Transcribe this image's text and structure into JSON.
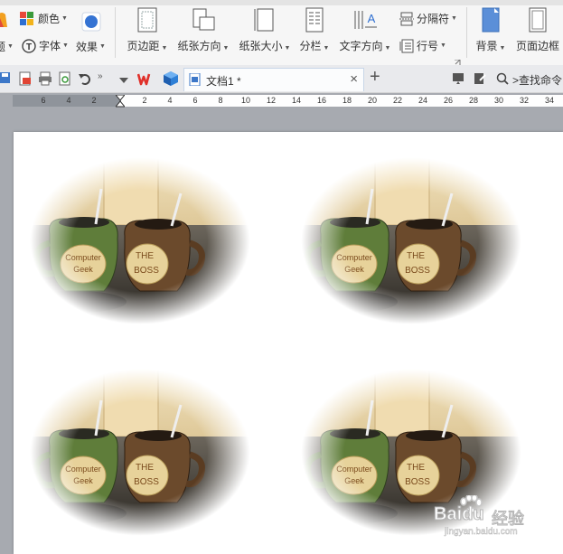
{
  "ribbon": {
    "color_label": "颜色",
    "font_label": "字体",
    "effect_label": "效果",
    "margin_label": "页边距",
    "orientation_label": "纸张方向",
    "size_label": "纸张大小",
    "columns_label": "分栏",
    "text_direction_label": "文字方向",
    "break_label": "分隔符",
    "line_number_label": "行号",
    "background_label": "背景",
    "page_border_label": "页面边框",
    "left_edge_label": "题"
  },
  "document_tab": {
    "title": "文档1 *",
    "close": "×",
    "new_tab": "+"
  },
  "search": {
    "label": ">查找命令"
  },
  "ruler": {
    "numbers": [
      "6",
      "4",
      "2",
      "2",
      "4",
      "6",
      "8",
      "10",
      "12",
      "14",
      "16",
      "18",
      "20",
      "22",
      "24",
      "26",
      "28",
      "30",
      "32",
      "34"
    ]
  },
  "document": {
    "photos": [
      {
        "mug1_text": "Computer Geek",
        "mug2_text": "THE BOSS"
      },
      {
        "mug1_text": "Computer Geek",
        "mug2_text": "THE BOSS"
      },
      {
        "mug1_text": "Computer Geek",
        "mug2_text": "THE BOSS"
      },
      {
        "mug1_text": "Computer Geek",
        "mug2_text": "THE BOSS"
      }
    ]
  },
  "watermark": {
    "brand": "Baidu",
    "subtitle": "经验",
    "url": "jingyan.baidu.com"
  }
}
